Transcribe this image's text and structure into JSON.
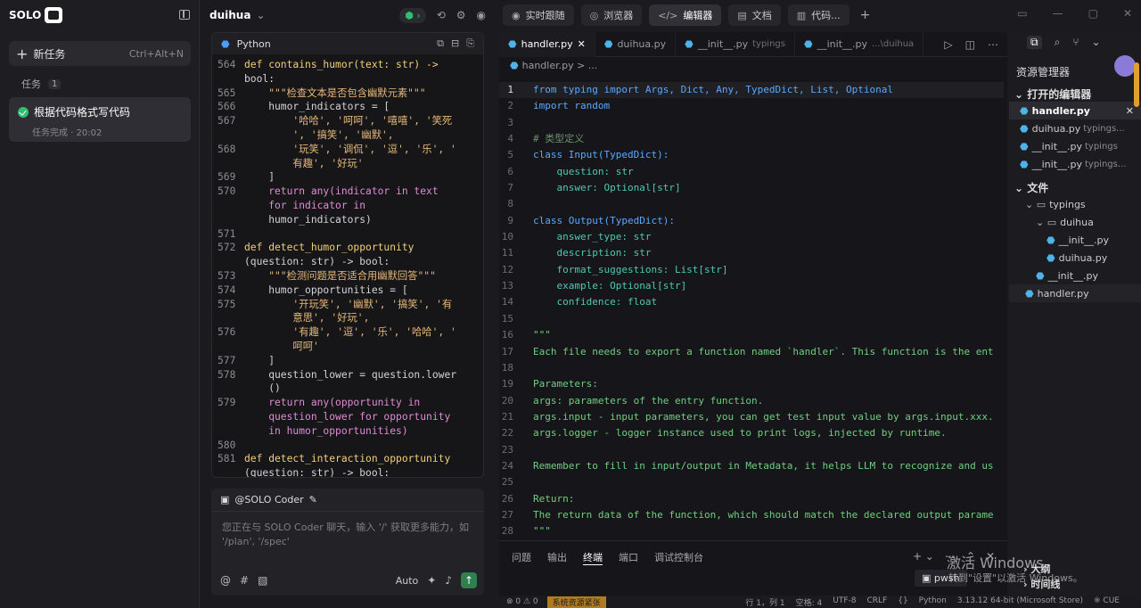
{
  "app": {
    "logo": "SOLO"
  },
  "left": {
    "new_task": "新任务",
    "new_task_shortcut": "Ctrl+Alt+N",
    "tasks_label": "任务",
    "tasks_count": "1",
    "task_title": "根据代码格式写代码",
    "task_status": "任务完成 · 20:02"
  },
  "mid": {
    "project": "duihua",
    "panel_lang": "Python",
    "code": [
      {
        "n": "564",
        "c": "def contains_humor(text: str) ->"
      },
      {
        "n": "",
        "c": "bool:"
      },
      {
        "n": "565",
        "c": "    \"\"\"检查文本是否包含幽默元素\"\"\""
      },
      {
        "n": "566",
        "c": "    humor_indicators = ["
      },
      {
        "n": "567",
        "c": "        '哈哈', '呵呵', '嘻嘻', '笑死"
      },
      {
        "n": "",
        "c": "        ', '搞笑', '幽默',"
      },
      {
        "n": "568",
        "c": "        '玩笑', '调侃', '逗', '乐', '"
      },
      {
        "n": "",
        "c": "        有趣', '好玩'"
      },
      {
        "n": "569",
        "c": "    ]"
      },
      {
        "n": "570",
        "c": "    return any(indicator in text"
      },
      {
        "n": "",
        "c": "    for indicator in"
      },
      {
        "n": "",
        "c": "    humor_indicators)"
      },
      {
        "n": "571",
        "c": ""
      },
      {
        "n": "572",
        "c": "def detect_humor_opportunity"
      },
      {
        "n": "",
        "c": "(question: str) -> bool:"
      },
      {
        "n": "573",
        "c": "    \"\"\"检测问题是否适合用幽默回答\"\"\""
      },
      {
        "n": "574",
        "c": "    humor_opportunities = ["
      },
      {
        "n": "575",
        "c": "        '开玩笑', '幽默', '搞笑', '有"
      },
      {
        "n": "",
        "c": "        意思', '好玩',"
      },
      {
        "n": "576",
        "c": "        '有趣', '逗', '乐', '哈哈', '"
      },
      {
        "n": "",
        "c": "        呵呵'"
      },
      {
        "n": "577",
        "c": "    ]"
      },
      {
        "n": "578",
        "c": "    question_lower = question.lower"
      },
      {
        "n": "",
        "c": "    ()"
      },
      {
        "n": "579",
        "c": "    return any(opportunity in"
      },
      {
        "n": "",
        "c": "    question_lower for opportunity"
      },
      {
        "n": "",
        "c": "    in humor_opportunities)"
      },
      {
        "n": "580",
        "c": ""
      },
      {
        "n": "581",
        "c": "def detect_interaction_opportunity"
      },
      {
        "n": "",
        "c": "(question: str) -> bool:"
      }
    ],
    "chat_header": "@SOLO Coder",
    "chat_placeholder": "您正在与 SOLO Coder 聊天，输入 '/' 获取更多能力，如 '/plan', '/spec'",
    "chat_mode": "Auto"
  },
  "topbar": {
    "tabs": [
      "实时跟随",
      "浏览器",
      "编辑器",
      "文档",
      "代码..."
    ]
  },
  "editor": {
    "tabs": [
      {
        "name": "handler.py",
        "sub": ""
      },
      {
        "name": "duihua.py",
        "sub": ""
      },
      {
        "name": "__init__.py",
        "sub": "typings"
      },
      {
        "name": "__init__.py",
        "sub": "...\\duihua"
      }
    ],
    "breadcrumb": "handler.py > ...",
    "lines": [
      "from typing import Args, Dict, Any, TypedDict, List, Optional",
      "import random",
      "",
      "# 类型定义",
      "class Input(TypedDict):",
      "    question: str",
      "    answer: Optional[str]",
      "",
      "class Output(TypedDict):",
      "    answer_type: str",
      "    description: str",
      "    format_suggestions: List[str]",
      "    example: Optional[str]",
      "    confidence: float",
      "",
      "\"\"\"",
      "Each file needs to export a function named `handler`. This function is the ent",
      "",
      "Parameters:",
      "args: parameters of the entry function.",
      "args.input - input parameters, you can get test input value by args.input.xxx.",
      "args.logger - logger instance used to print logs, injected by runtime.",
      "",
      "Remember to fill in input/output in Metadata, it helps LLM to recognize and us",
      "",
      "Return:",
      "The return data of the function, which should match the declared output parame",
      "\"\"\""
    ],
    "panel_tabs": [
      "问题",
      "输出",
      "终端",
      "端口",
      "调试控制台"
    ],
    "terminal": "pwsh"
  },
  "status": {
    "errors": "⊗ 0 ⚠ 0",
    "warn": "系统资源紧张",
    "right": [
      "行 1，列 1",
      "空格: 4",
      "UTF-8",
      "CRLF",
      "{}",
      "Python",
      "3.13.12 64-bit (Microsoft Store)",
      "※ CUE"
    ]
  },
  "explorer": {
    "title": "资源管理器",
    "open_editors": "打开的编辑器",
    "open_files": [
      {
        "name": "handler.py",
        "sub": ""
      },
      {
        "name": "duihua.py",
        "sub": "typings..."
      },
      {
        "name": "__init__.py",
        "sub": "typings"
      },
      {
        "name": "__init__.py",
        "sub": "typings..."
      }
    ],
    "files_section": "文件",
    "tree": [
      {
        "name": "typings",
        "indent": 1,
        "folder": true
      },
      {
        "name": "duihua",
        "indent": 2,
        "folder": true
      },
      {
        "name": "__init__.py",
        "indent": 3
      },
      {
        "name": "duihua.py",
        "indent": 3
      },
      {
        "name": "__init__.py",
        "indent": 2
      },
      {
        "name": "handler.py",
        "indent": 1
      }
    ],
    "outline": "大纲",
    "timeline": "时间线"
  },
  "watermark": {
    "line1": "激活 Windows",
    "line2": "转到\"设置\"以激活 Windows。"
  }
}
